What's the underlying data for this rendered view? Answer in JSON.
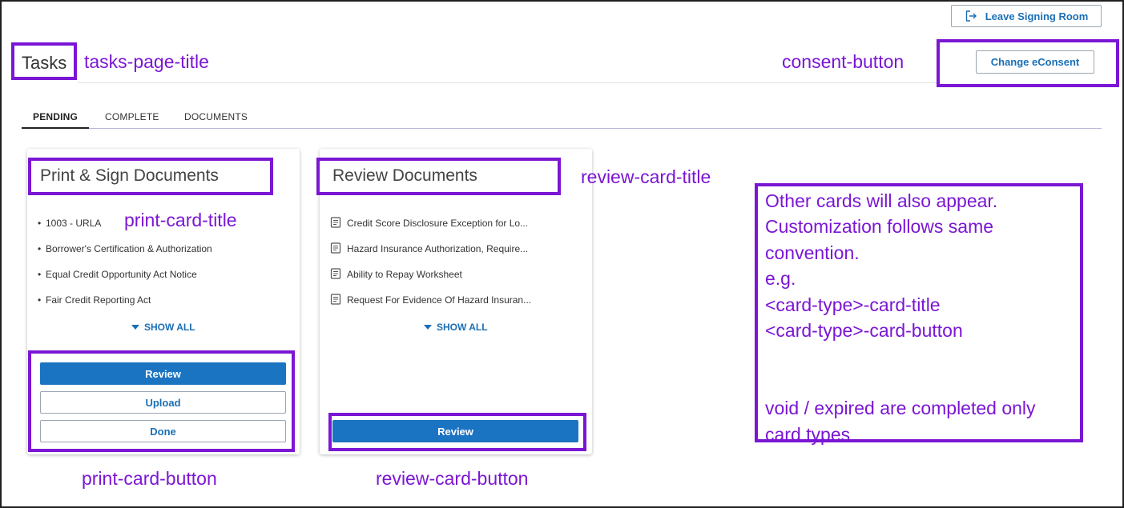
{
  "header": {
    "leave_label": "Leave Signing Room",
    "title": "Tasks",
    "consent_label": "Change eConsent"
  },
  "tabs": [
    {
      "label": "PENDING",
      "active": true
    },
    {
      "label": "COMPLETE",
      "active": false
    },
    {
      "label": "DOCUMENTS",
      "active": false
    }
  ],
  "print_card": {
    "title": "Print & Sign Documents",
    "items": [
      "1003 - URLA",
      "Borrower's Certification & Authorization",
      "Equal Credit Opportunity Act Notice",
      "Fair Credit Reporting Act"
    ],
    "show_all": "SHOW ALL",
    "buttons": {
      "review": "Review",
      "upload": "Upload",
      "done": "Done"
    }
  },
  "review_card": {
    "title": "Review Documents",
    "items": [
      "Credit Score Disclosure Exception for Lo...",
      "Hazard Insurance Authorization, Require...",
      "Ability to Repay Worksheet",
      "Request For Evidence Of Hazard Insuran..."
    ],
    "show_all": "SHOW ALL",
    "buttons": {
      "review": "Review"
    }
  },
  "annotations": {
    "tasks_page_title": "tasks-page-title",
    "consent_button": "consent-button",
    "print_card_title": "print-card-title",
    "review_card_title": "review-card-title",
    "print_card_button": "print-card-button",
    "review_card_button": "review-card-button",
    "note_lines": [
      "Other cards will also appear.",
      "Customization follows same",
      "convention.",
      "e.g.",
      "<card-type>-card-title",
      "<card-type>-card-button",
      "",
      "",
      "void / expired are completed only",
      "card types"
    ]
  },
  "colors": {
    "annotation": "#7b16d4",
    "primary": "#1b74c2",
    "link": "#1b6fb5"
  },
  "icons": {
    "leave": "exit-icon",
    "document": "document-icon",
    "show_all": "caret-down-icon"
  }
}
